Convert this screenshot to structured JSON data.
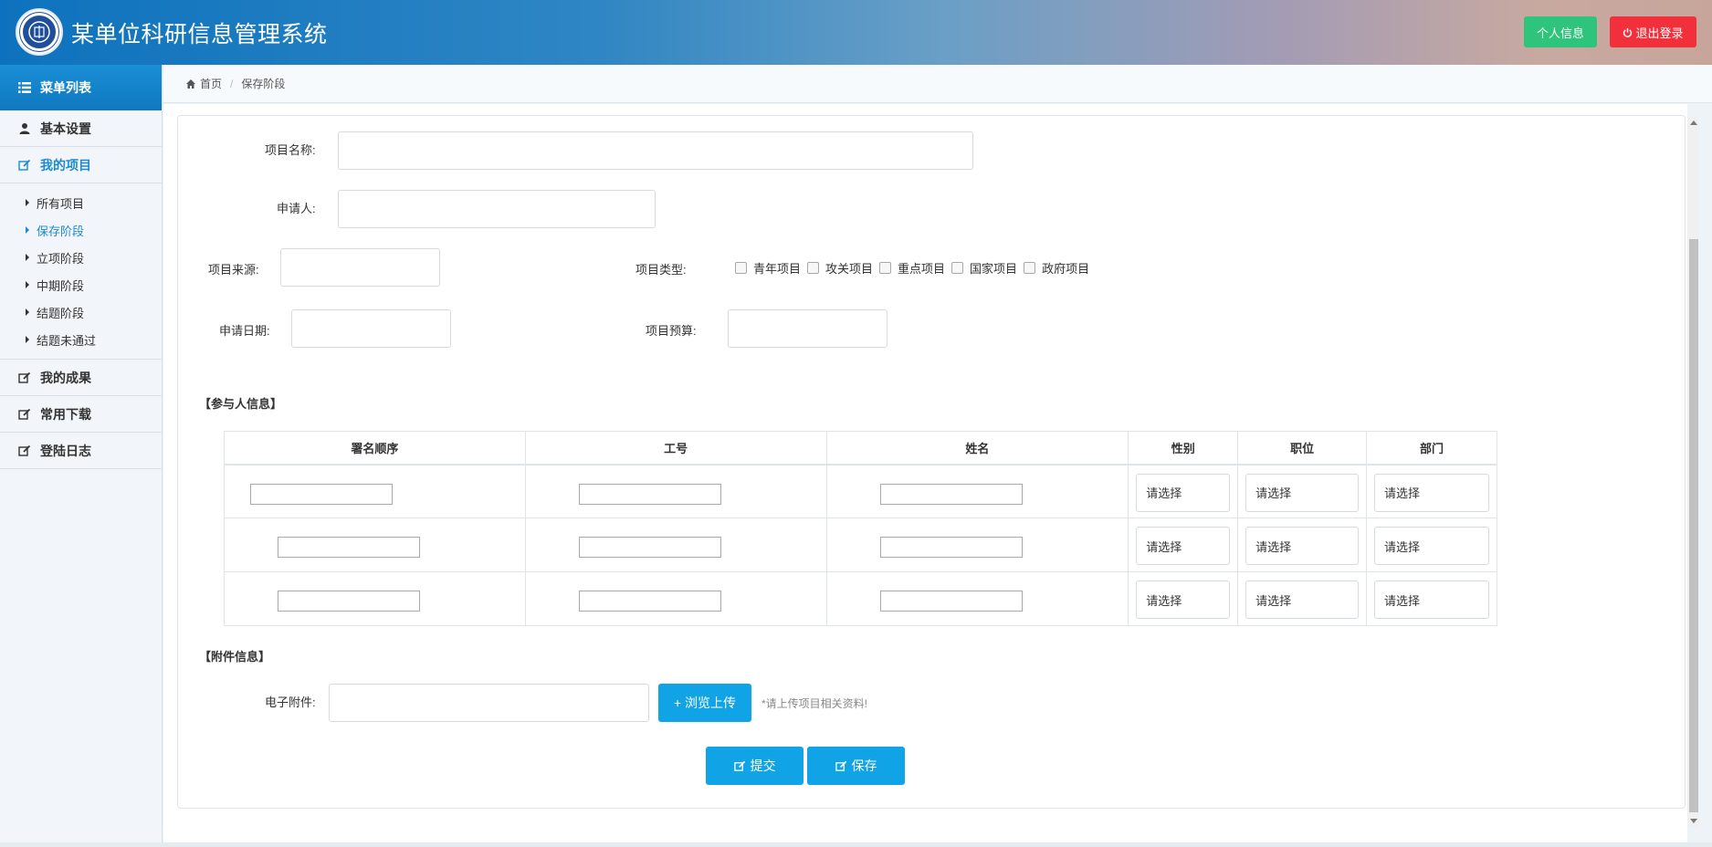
{
  "header": {
    "title": "某单位科研信息管理系统",
    "profile_button": "个人信息",
    "logout_button": "退出登录",
    "logo_icon": "university-seal-icon"
  },
  "sidebar": {
    "menu_title": "菜单列表",
    "items": [
      {
        "label": "基本设置",
        "icon": "user-icon"
      },
      {
        "label": "我的项目",
        "icon": "edit-icon",
        "active": true
      },
      {
        "label": "我的成果",
        "icon": "edit-icon"
      },
      {
        "label": "常用下载",
        "icon": "edit-icon"
      },
      {
        "label": "登陆日志",
        "icon": "edit-icon"
      }
    ],
    "sub_items": [
      "所有项目",
      "保存阶段",
      "立项阶段",
      "中期阶段",
      "结题阶段",
      "结题未通过"
    ],
    "active_sub": "保存阶段"
  },
  "breadcrumb": {
    "home": "首页",
    "current": "保存阶段"
  },
  "form": {
    "project_name_label": "项目名称:",
    "applicant_label": "申请人:",
    "source_label": "项目来源:",
    "type_label": "项目类型:",
    "type_options": [
      "青年项目",
      "攻关项目",
      "重点项目",
      "国家项目",
      "政府项目"
    ],
    "date_label": "申请日期:",
    "budget_label": "项目预算:",
    "participants_title": "【参与人信息】",
    "attachments_title": "【附件信息】",
    "attachment_label": "电子附件:",
    "upload_button": "+ 浏览上传",
    "upload_hint": "*请上传项目相关资料!",
    "submit_button": "提交",
    "save_button": "保存"
  },
  "participants_table": {
    "columns": [
      "署名顺序",
      "工号",
      "姓名",
      "性别",
      "职位",
      "部门"
    ],
    "rows": [
      {
        "gender": "请选择",
        "position": "请选择",
        "department": "请选择"
      },
      {
        "gender": "请选择",
        "position": "请选择",
        "department": "请选择"
      },
      {
        "gender": "请选择",
        "position": "请选择",
        "department": "请选择"
      }
    ]
  },
  "colors": {
    "primary": "#10a3e6",
    "profile_green": "#2ec47b",
    "logout_red": "#f1303c",
    "active_blue": "#1b8ad3"
  }
}
